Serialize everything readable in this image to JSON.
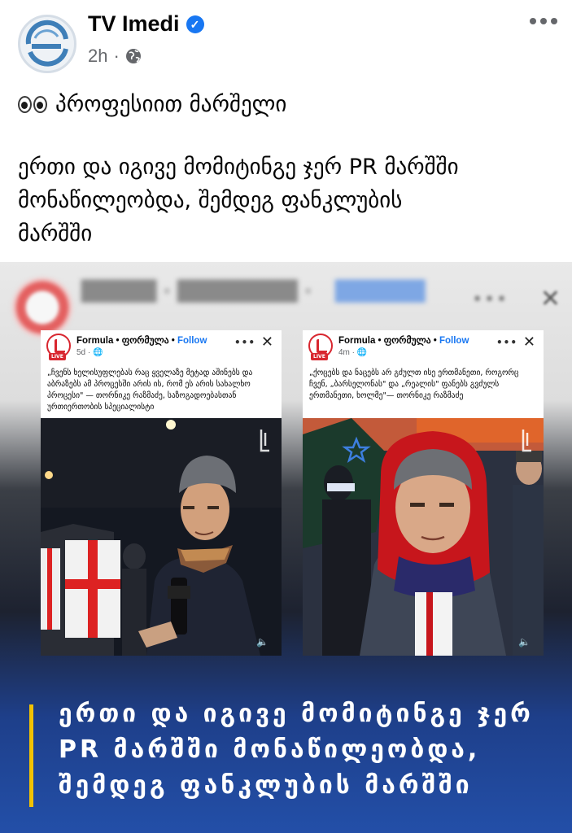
{
  "post": {
    "author": "TV Imedi",
    "time": "2h",
    "verified": true,
    "caption_line1": "პროფესიით მარშელი",
    "caption_line2": "ერთი და იგივე მომიტინგე  ჯერ PR მარშში",
    "caption_line3": "მონაწილეობდა, შემდეგ ფანკლუბის",
    "caption_line4": "მარშში"
  },
  "image": {
    "left_card": {
      "name": "Formula • ფორმულა • ",
      "follow": "Follow",
      "time": "5d · ",
      "live_badge": "LIVE",
      "text": "„ჩვენს ხელისუფლებას რაც ყველაზე მეტად აშინებს და აბრაზებს ამ პროცესში არის ის, რომ ეს არის სახალხო პროცესი\" — თორნიკე რაზმაძე, საზოგადოებასთან ურთიერთობის სპეციალისტი"
    },
    "right_card": {
      "name": "Formula • ფორმულა • ",
      "follow": "Follow",
      "time": "4m · ",
      "live_badge": "LIVE",
      "text": "„ქოცებს და ნაცებს არ გძულთ ისე ერთმანეთი, როგორც ჩვენ, „ბარსელონას\" და „რეალის\" ფანებს გვძულს ერთმანეთი, ხოლმე\"— თორნიკე რაზმაძე"
    },
    "overlay_line1": "ერთი და იგივე მომიტინგე  ჯერ",
    "overlay_line2": "PR მარშში მონაწილეობდა,",
    "overlay_line3": "შემდეგ ფანკლუბის მარშში"
  },
  "colors": {
    "verified_blue": "#1877f2",
    "accent_yellow": "#f2c200",
    "brand_red": "#d8262f"
  }
}
